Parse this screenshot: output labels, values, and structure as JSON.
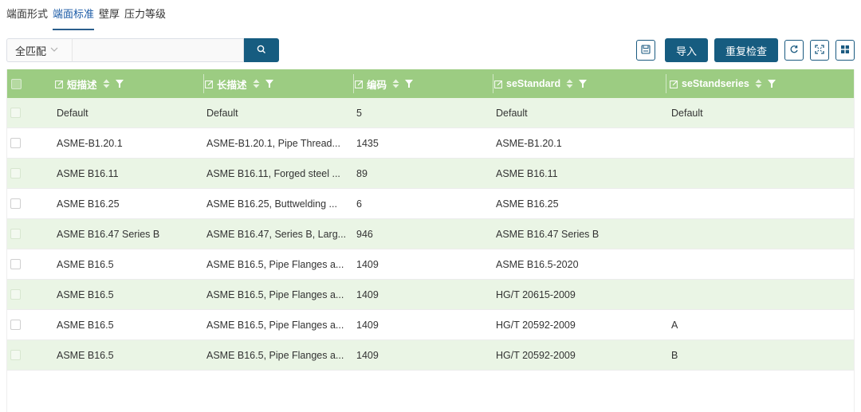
{
  "tabs": [
    {
      "label": "端面形式",
      "active": false
    },
    {
      "label": "端面标准",
      "active": true
    },
    {
      "label": "壁厚",
      "active": false
    },
    {
      "label": "压力等级",
      "active": false
    }
  ],
  "toolbar": {
    "match_mode": "全匹配",
    "search_value": "",
    "import_label": "导入",
    "recheck_label": "重复检查"
  },
  "icons": {
    "save": "save-icon",
    "search": "search-icon",
    "refresh": "refresh-icon",
    "fullscreen": "fullscreen-icon",
    "layout": "layout-icon"
  },
  "colors": {
    "accent": "#165c80",
    "header_bg": "#9ccc82",
    "stripe": "#eaf5e5",
    "active_tab": "#1a5aa6"
  },
  "grid": {
    "columns": [
      {
        "label": "短描述"
      },
      {
        "label": "长描述"
      },
      {
        "label": "编码"
      },
      {
        "label": "seStandard"
      },
      {
        "label": "seStandseries"
      }
    ],
    "rows": [
      [
        "Default",
        "Default",
        "5",
        "Default",
        "Default"
      ],
      [
        "ASME-B1.20.1",
        "ASME-B1.20.1, Pipe Thread...",
        "1435",
        "ASME-B1.20.1",
        ""
      ],
      [
        "ASME B16.11",
        "ASME B16.11, Forged steel ...",
        "89",
        "ASME B16.11",
        ""
      ],
      [
        "ASME B16.25",
        "ASME B16.25, Buttwelding ...",
        "6",
        "ASME B16.25",
        ""
      ],
      [
        "ASME B16.47 Series B",
        "ASME B16.47, Series B, Larg...",
        "946",
        "ASME B16.47 Series B",
        ""
      ],
      [
        "ASME B16.5",
        "ASME B16.5, Pipe Flanges a...",
        "1409",
        "ASME B16.5-2020",
        ""
      ],
      [
        "ASME B16.5",
        "ASME B16.5, Pipe Flanges a...",
        "1409",
        "HG/T 20615-2009",
        ""
      ],
      [
        "ASME B16.5",
        "ASME B16.5, Pipe Flanges a...",
        "1409",
        "HG/T 20592-2009",
        "A"
      ],
      [
        "ASME B16.5",
        "ASME B16.5, Pipe Flanges a...",
        "1409",
        "HG/T 20592-2009",
        "B"
      ]
    ]
  }
}
